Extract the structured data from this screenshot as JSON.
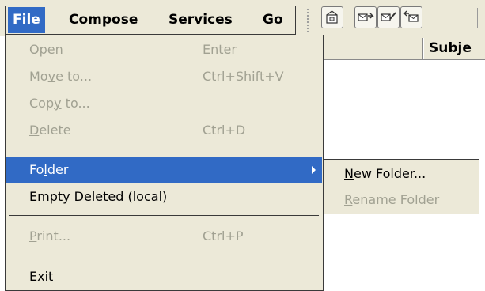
{
  "menubar": {
    "menus": [
      {
        "access": "F",
        "rest": "ile",
        "active": true
      },
      {
        "access": "C",
        "rest": "ompose",
        "active": false
      },
      {
        "access": "S",
        "rest": "ervices",
        "active": false
      },
      {
        "access": "G",
        "rest": "o",
        "active": false
      }
    ]
  },
  "toolbar": {
    "icons": [
      "move-to-icon",
      "message-forward-icon",
      "message-edit-icon",
      "message-reply-icon"
    ]
  },
  "list_header": {
    "subject_label": "Subje"
  },
  "file_menu": {
    "items": [
      {
        "pre": "",
        "acc": "O",
        "post": "pen",
        "shortcut": "Enter",
        "enabled": false
      },
      {
        "pre": "Mo",
        "acc": "v",
        "post": "e to...",
        "shortcut": "Ctrl+Shift+V",
        "enabled": false
      },
      {
        "pre": "Cop",
        "acc": "y",
        "post": " to...",
        "shortcut": "",
        "enabled": false
      },
      {
        "pre": "",
        "acc": "D",
        "post": "elete",
        "shortcut": "Ctrl+D",
        "enabled": false
      },
      {
        "pre": "Fo",
        "acc": "l",
        "post": "der",
        "shortcut": "",
        "enabled": true,
        "highlighted": true,
        "submenu": true
      },
      {
        "pre": "",
        "acc": "E",
        "post": "mpty Deleted (local)",
        "shortcut": "",
        "enabled": true
      },
      {
        "pre": "",
        "acc": "P",
        "post": "rint...",
        "shortcut": "Ctrl+P",
        "enabled": false
      },
      {
        "pre": "E",
        "acc": "x",
        "post": "it",
        "shortcut": "",
        "enabled": true
      }
    ]
  },
  "folder_submenu": {
    "items": [
      {
        "pre": "",
        "acc": "N",
        "post": "ew Folder...",
        "enabled": true
      },
      {
        "pre": "",
        "acc": "R",
        "post": "ename Folder",
        "enabled": false
      }
    ]
  },
  "colors": {
    "menu_background": "#ece9d8",
    "highlight": "#316ac5",
    "disabled_text": "#a1a192"
  }
}
